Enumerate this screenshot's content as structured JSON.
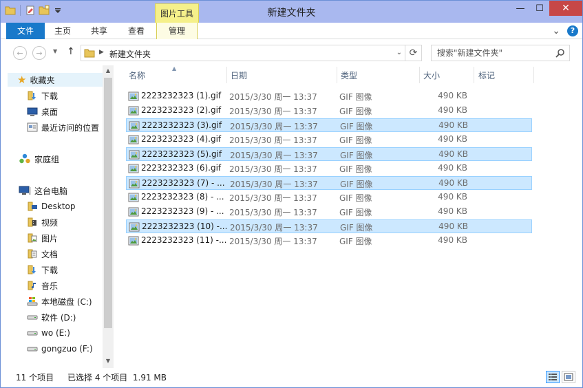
{
  "window": {
    "title": "新建文件夹",
    "context_tab_title": "图片工具",
    "controls": {
      "minimize": "—",
      "maximize": "☐",
      "close": "✕"
    }
  },
  "ribbon": {
    "tabs": [
      "文件",
      "主页",
      "共享",
      "查看",
      "管理"
    ],
    "expand_glyph": "⌄",
    "help_glyph": "?"
  },
  "address": {
    "path": "新建文件夹",
    "search_placeholder": "搜索\"新建文件夹\""
  },
  "nav": {
    "favorites": {
      "label": "收藏夹",
      "items": [
        "下载",
        "桌面",
        "最近访问的位置"
      ]
    },
    "homegroup": "家庭组",
    "thispc": {
      "label": "这台电脑",
      "items": [
        "Desktop",
        "视频",
        "图片",
        "文档",
        "下载",
        "音乐",
        "本地磁盘 (C:)",
        "软件 (D:)",
        "wo (E:)",
        "gongzuo (F:)"
      ]
    }
  },
  "list": {
    "columns": [
      "名称",
      "日期",
      "类型",
      "大小",
      "标记"
    ],
    "rows": [
      {
        "name": "2223232323 (1).gif",
        "date": "2015/3/30 周一 13:37",
        "type": "GIF 图像",
        "size": "490 KB",
        "selected": false
      },
      {
        "name": "2223232323 (2).gif",
        "date": "2015/3/30 周一 13:37",
        "type": "GIF 图像",
        "size": "490 KB",
        "selected": false
      },
      {
        "name": "2223232323 (3).gif",
        "date": "2015/3/30 周一 13:37",
        "type": "GIF 图像",
        "size": "490 KB",
        "selected": true
      },
      {
        "name": "2223232323 (4).gif",
        "date": "2015/3/30 周一 13:37",
        "type": "GIF 图像",
        "size": "490 KB",
        "selected": false
      },
      {
        "name": "2223232323 (5).gif",
        "date": "2015/3/30 周一 13:37",
        "type": "GIF 图像",
        "size": "490 KB",
        "selected": true
      },
      {
        "name": "2223232323 (6).gif",
        "date": "2015/3/30 周一 13:37",
        "type": "GIF 图像",
        "size": "490 KB",
        "selected": false
      },
      {
        "name": "2223232323 (7) - ...",
        "date": "2015/3/30 周一 13:37",
        "type": "GIF 图像",
        "size": "490 KB",
        "selected": true
      },
      {
        "name": "2223232323 (8) - ...",
        "date": "2015/3/30 周一 13:37",
        "type": "GIF 图像",
        "size": "490 KB",
        "selected": false
      },
      {
        "name": "2223232323 (9) - ...",
        "date": "2015/3/30 周一 13:37",
        "type": "GIF 图像",
        "size": "490 KB",
        "selected": false
      },
      {
        "name": "2223232323 (10) -...",
        "date": "2015/3/30 周一 13:37",
        "type": "GIF 图像",
        "size": "490 KB",
        "selected": true
      },
      {
        "name": "2223232323 (11) -...",
        "date": "2015/3/30 周一 13:37",
        "type": "GIF 图像",
        "size": "490 KB",
        "selected": false
      }
    ]
  },
  "status": {
    "count": "11 个项目",
    "selection": "已选择 4 个项目  1.91 MB"
  },
  "colors": {
    "title_bar": "#a9b8ef",
    "file_tab": "#1979ca",
    "context_tab": "#f5f08a",
    "selection": "#cce8ff",
    "close_button": "#c74747"
  }
}
